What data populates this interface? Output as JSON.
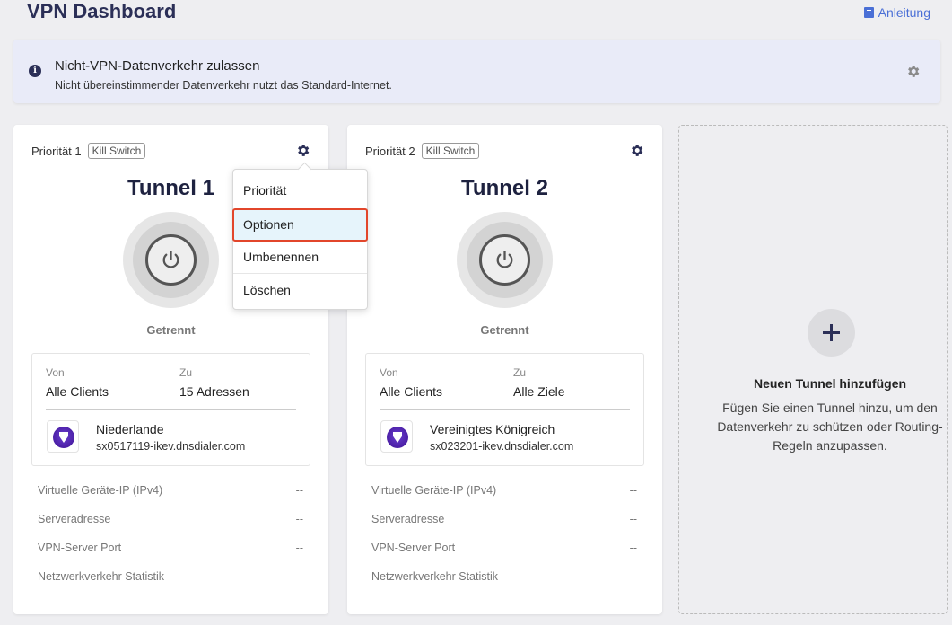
{
  "page": {
    "title": "VPN Dashboard",
    "guide_link": "Anleitung"
  },
  "banner": {
    "title": "Nicht-VPN-Datenverkehr zulassen",
    "subtitle": "Nicht übereinstimmender Datenverkehr nutzt das Standard-Internet."
  },
  "tunnels": [
    {
      "priority": "Priorität 1",
      "kill_switch": "Kill Switch",
      "name": "Tunnel 1",
      "status": "Getrennt",
      "from_label": "Von",
      "from_value": "Alle Clients",
      "to_label": "Zu",
      "to_value": "15 Adressen",
      "server_country": "Niederlande",
      "server_host": "sx0517119-ikev.dnsdialer.com",
      "stats": [
        {
          "label": "Virtuelle Geräte-IP (IPv4)",
          "value": "--"
        },
        {
          "label": "Serveradresse",
          "value": "--"
        },
        {
          "label": "VPN-Server Port",
          "value": "--"
        },
        {
          "label": "Netzwerkverkehr Statistik",
          "value": "--"
        }
      ]
    },
    {
      "priority": "Priorität 2",
      "kill_switch": "Kill Switch",
      "name": "Tunnel 2",
      "status": "Getrennt",
      "from_label": "Von",
      "from_value": "Alle Clients",
      "to_label": "Zu",
      "to_value": "Alle Ziele",
      "server_country": "Vereinigtes Königreich",
      "server_host": "sx023201-ikev.dnsdialer.com",
      "stats": [
        {
          "label": "Virtuelle Geräte-IP (IPv4)",
          "value": "--"
        },
        {
          "label": "Serveradresse",
          "value": "--"
        },
        {
          "label": "VPN-Server Port",
          "value": "--"
        },
        {
          "label": "Netzwerkverkehr Statistik",
          "value": "--"
        }
      ]
    }
  ],
  "dropdown": {
    "items": [
      "Priorität",
      "Optionen",
      "Umbenennen",
      "Löschen"
    ],
    "highlighted": "Optionen"
  },
  "add_tunnel": {
    "title": "Neuen Tunnel hinzufügen",
    "description": "Fügen Sie einen Tunnel hinzu, um den Datenverkehr zu schützen oder Routing-Regeln anzupassen."
  },
  "colors": {
    "accent": "#2b2f57",
    "link": "#4a6fd6",
    "highlight_border": "#e2462b",
    "server_icon": "#4b1fa5"
  }
}
